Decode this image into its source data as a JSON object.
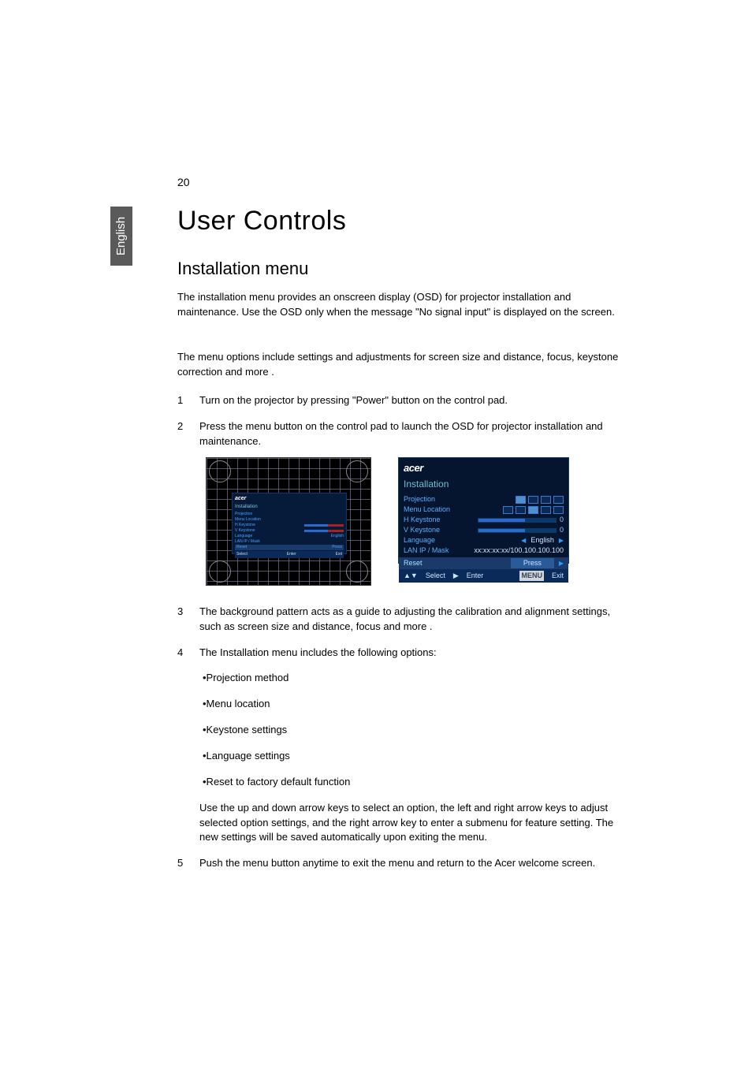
{
  "page_number": "20",
  "language_tab": "English",
  "title": "User Controls",
  "heading": "Installation menu",
  "intro1": "The installation menu provides an onscreen display (OSD) for projector installation and maintenance. Use the OSD only when the message \"No signal input\" is displayed on the screen.",
  "intro2": "The menu options include settings and adjustments for screen size and distance, focus, keystone correction and more .",
  "steps": {
    "s1": {
      "n": "1",
      "t": "Turn on the projector by pressing \"Power\" button on the control pad."
    },
    "s2": {
      "n": "2",
      "t": "Press the menu button on the control pad to launch the OSD for projector installation and maintenance."
    },
    "s3": {
      "n": "3",
      "t": "The background pattern acts as a guide to adjusting the calibration and alignment settings, such as screen size and distance, focus and more ."
    },
    "s4": {
      "n": "4",
      "t": "The Installation menu includes the following options:",
      "bullets": {
        "b1": "•Projection method",
        "b2": "•Menu location",
        "b3": "•Keystone settings",
        "b4": "•Language settings",
        "b5": "•Reset to factory default function"
      },
      "after": "Use the up and down arrow keys to select an option, the left and right arrow keys to adjust selected option settings, and the right arrow key to enter a submenu for feature setting. The new settings will be saved automatically upon exiting the menu."
    },
    "s5": {
      "n": "5",
      "t": "Push the menu button anytime to exit the menu and return to the Acer welcome screen."
    }
  },
  "osd": {
    "brand": "acer",
    "title": "Installation",
    "rows": {
      "projection": "Projection",
      "menu_location": "Menu Location",
      "h_keystone": "H Keystone",
      "v_keystone": "V Keystone",
      "language": "Language",
      "language_value": "English",
      "lan": "LAN IP / Mask",
      "lan_value": "xx:xx:xx:xx/100.100.100.100",
      "reset": "Reset",
      "press": "Press",
      "zero": "0"
    },
    "footer": {
      "select": "Select",
      "enter": "Enter",
      "menu": "MENU",
      "exit": "Exit"
    }
  }
}
